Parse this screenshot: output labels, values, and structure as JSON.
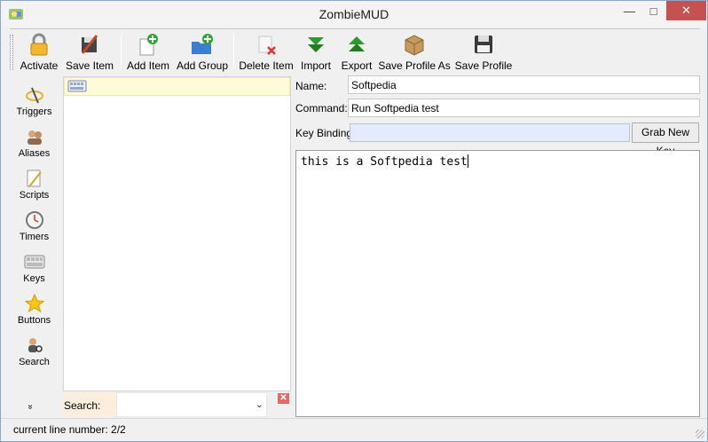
{
  "window": {
    "title": "ZombieMUD"
  },
  "toolbar": {
    "items": [
      {
        "label": "Activate",
        "icon": "lock-icon"
      },
      {
        "label": "Save Item",
        "icon": "save-item-icon"
      },
      {
        "label": "Add Item",
        "icon": "add-item-icon"
      },
      {
        "label": "Add Group",
        "icon": "add-group-icon"
      },
      {
        "label": "Delete Item",
        "icon": "delete-item-icon"
      },
      {
        "label": "Import",
        "icon": "import-arrow-icon"
      },
      {
        "label": "Export",
        "icon": "export-arrow-icon"
      },
      {
        "label": "Save Profile As",
        "icon": "package-icon"
      },
      {
        "label": "Save Profile",
        "icon": "floppy-disk-icon"
      }
    ]
  },
  "sidebar": {
    "items": [
      {
        "label": "Triggers",
        "icon": "triggers-icon"
      },
      {
        "label": "Aliases",
        "icon": "aliases-icon"
      },
      {
        "label": "Scripts",
        "icon": "scripts-icon"
      },
      {
        "label": "Timers",
        "icon": "clock-icon"
      },
      {
        "label": "Keys",
        "icon": "keyboard-icon"
      },
      {
        "label": "Buttons",
        "icon": "star-icon"
      },
      {
        "label": "Search",
        "icon": "search-person-icon"
      }
    ],
    "more": "»"
  },
  "search": {
    "label": "Search:",
    "value": ""
  },
  "form": {
    "name_label": "Name:",
    "name_value": "Softpedia",
    "command_label": "Command:",
    "command_value": "Run Softpedia test",
    "keybinding_label": "Key Binding:",
    "keybinding_value": "",
    "grab_button": "Grab New Key",
    "script_text": "this is a Softpedia test"
  },
  "status": {
    "text": "current line number: 2/2"
  },
  "colors": {
    "close_button": "#c75050",
    "tree_selected_row": "#fdfbd8",
    "keybinding_field": "#e3ebfc",
    "search_label_bg": "#fbeedd"
  }
}
